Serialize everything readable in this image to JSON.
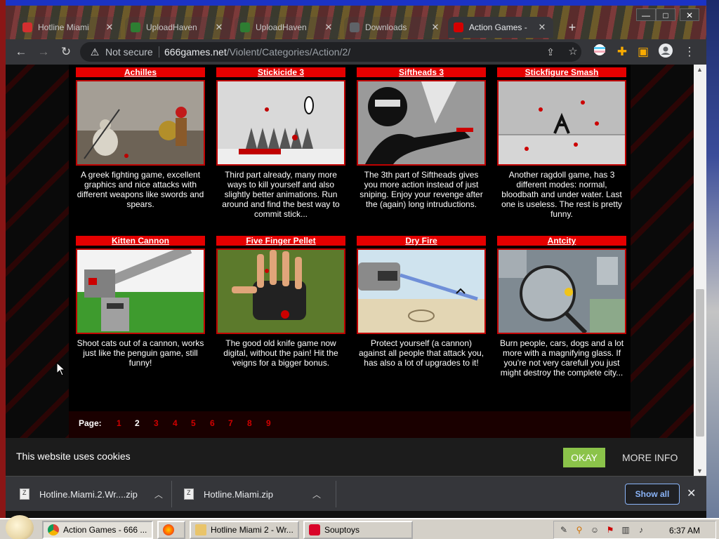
{
  "browser": {
    "tabs": [
      {
        "title": "Hotline Miami",
        "favicon_color": "#d32f2f",
        "active": false
      },
      {
        "title": "UploadHaven",
        "favicon_color": "#2e7d32",
        "active": false
      },
      {
        "title": "UploadHaven",
        "favicon_color": "#2e7d32",
        "active": false
      },
      {
        "title": "Downloads",
        "favicon_color": "#5f6368",
        "active": false
      },
      {
        "title": "Action Games -",
        "favicon_color": "#d50000",
        "active": true
      }
    ],
    "window_controls": {
      "minimize": "—",
      "maximize": "□",
      "close": "✕"
    },
    "address": {
      "security_text": "Not secure",
      "domain": "666games.net",
      "path": "/Violent/Categories/Action/2/"
    }
  },
  "games": [
    {
      "title": "Achilles",
      "desc": "A greek fighting game, excellent graphics and nice attacks with different weapons like swords and spears."
    },
    {
      "title": "Stickicide 3",
      "desc": "Third part already, many more ways to kill yourself and also slightly better animations. Run around and find the best way to commit stick..."
    },
    {
      "title": "Siftheads 3",
      "desc": "The 3th part of Siftheads gives you more action instead of just sniping. Enjoy your revenge after the (again) long intruductions."
    },
    {
      "title": "Stickfigure Smash",
      "desc": "Another ragdoll game, has 3 different modes: normal, bloodbath and under water. Last one is useless. The rest is pretty funny."
    },
    {
      "title": "Kitten Cannon",
      "desc": "Shoot cats out of a cannon, works just like the penguin game, still funny!"
    },
    {
      "title": "Five Finger Pellet",
      "desc": "The good old knife game now digital, without the pain! Hit the veigns for a bigger bonus."
    },
    {
      "title": "Dry Fire",
      "desc": "Protect yourself (a cannon) against all people that attack you, has also a lot of upgrades to it!"
    },
    {
      "title": "Antcity",
      "desc": "Burn people, cars, dogs and a lot more with a magnifying glass. If you're not very carefull you just might destroy the complete city..."
    }
  ],
  "pagination": {
    "label": "Page:",
    "pages": [
      "1",
      "2",
      "3",
      "4",
      "5",
      "6",
      "7",
      "8",
      "9"
    ],
    "current": "2"
  },
  "cookie": {
    "message": "This website uses cookies",
    "okay": "OKAY",
    "more_info": "MORE INFO"
  },
  "downloads": {
    "items": [
      "Hotline.Miami.2.Wr....zip",
      "Hotline.Miami.zip"
    ],
    "show_all": "Show all"
  },
  "taskbar": {
    "buttons": [
      {
        "label": "Action Games - 666 ...",
        "icon": "chrome-icon",
        "pressed": true
      },
      {
        "label": "",
        "icon": "firefox-icon",
        "pressed": false
      },
      {
        "label": "Hotline Miami 2 - Wr...",
        "icon": "folder-icon",
        "pressed": false
      },
      {
        "label": "Souptoys",
        "icon": "souptoys-icon",
        "pressed": false
      }
    ],
    "clock": "6:37 AM"
  }
}
